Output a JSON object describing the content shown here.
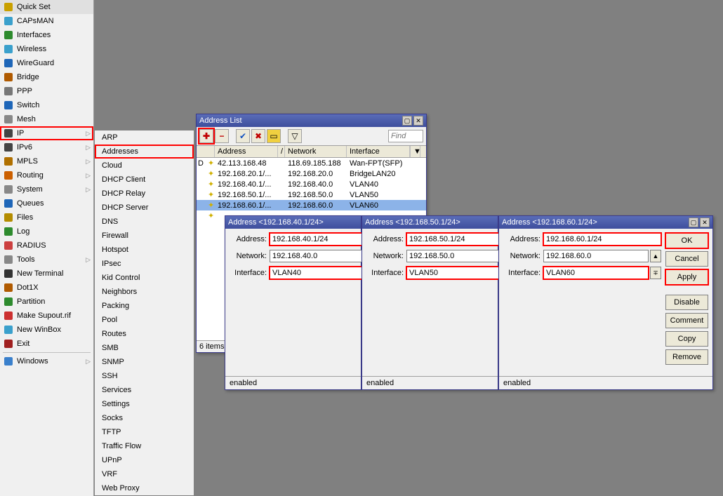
{
  "sidebar": [
    {
      "label": "Quick Set",
      "icon": "#c9a000",
      "arrow": false
    },
    {
      "label": "CAPsMAN",
      "icon": "#3aa0cc",
      "arrow": false
    },
    {
      "label": "Interfaces",
      "icon": "#2e8b2e",
      "arrow": false
    },
    {
      "label": "Wireless",
      "icon": "#3aa0cc",
      "arrow": false
    },
    {
      "label": "WireGuard",
      "icon": "#1e66b8",
      "arrow": false
    },
    {
      "label": "Bridge",
      "icon": "#b05a00",
      "arrow": false
    },
    {
      "label": "PPP",
      "icon": "#777",
      "arrow": false
    },
    {
      "label": "Switch",
      "icon": "#1e66b8",
      "arrow": false
    },
    {
      "label": "Mesh",
      "icon": "#888",
      "arrow": false
    },
    {
      "label": "IP",
      "icon": "#444",
      "arrow": true,
      "highlight": true
    },
    {
      "label": "IPv6",
      "icon": "#444",
      "arrow": true
    },
    {
      "label": "MPLS",
      "icon": "#b07000",
      "arrow": true
    },
    {
      "label": "Routing",
      "icon": "#cc6000",
      "arrow": true
    },
    {
      "label": "System",
      "icon": "#888",
      "arrow": true
    },
    {
      "label": "Queues",
      "icon": "#1e66b8",
      "arrow": false
    },
    {
      "label": "Files",
      "icon": "#b48c00",
      "arrow": false
    },
    {
      "label": "Log",
      "icon": "#2e8b2e",
      "arrow": false
    },
    {
      "label": "RADIUS",
      "icon": "#cc4040",
      "arrow": false
    },
    {
      "label": "Tools",
      "icon": "#888",
      "arrow": true
    },
    {
      "label": "New Terminal",
      "icon": "#333",
      "arrow": false
    },
    {
      "label": "Dot1X",
      "icon": "#b05a00",
      "arrow": false
    },
    {
      "label": "Partition",
      "icon": "#2e8b2e",
      "arrow": false
    },
    {
      "label": "Make Supout.rif",
      "icon": "#cc3030",
      "arrow": false
    },
    {
      "label": "New WinBox",
      "icon": "#3aa0cc",
      "arrow": false
    },
    {
      "label": "Exit",
      "icon": "#a02020",
      "arrow": false
    },
    {
      "label": "Windows",
      "icon": "#3a80cc",
      "arrow": true,
      "divider": true
    }
  ],
  "submenu": [
    "ARP",
    "Addresses",
    "Cloud",
    "DHCP Client",
    "DHCP Relay",
    "DHCP Server",
    "DNS",
    "Firewall",
    "Hotspot",
    "IPsec",
    "Kid Control",
    "Neighbors",
    "Packing",
    "Pool",
    "Routes",
    "SMB",
    "SNMP",
    "SSH",
    "Services",
    "Settings",
    "Socks",
    "TFTP",
    "Traffic Flow",
    "UPnP",
    "VRF",
    "Web Proxy"
  ],
  "submenu_highlight": 1,
  "addressList": {
    "title": "Address List",
    "find_placeholder": "Find",
    "headers": [
      "Address",
      "Network",
      "Interface"
    ],
    "rows": [
      {
        "flag": "D",
        "addr": "42.113.168.48",
        "net": "118.69.185.188",
        "if": "Wan-FPT(SFP)",
        "sel": false
      },
      {
        "flag": "",
        "addr": "192.168.20.1/...",
        "net": "192.168.20.0",
        "if": "BridgeLAN20",
        "sel": false
      },
      {
        "flag": "",
        "addr": "192.168.40.1/...",
        "net": "192.168.40.0",
        "if": "VLAN40",
        "sel": false
      },
      {
        "flag": "",
        "addr": "192.168.50.1/...",
        "net": "192.168.50.0",
        "if": "VLAN50",
        "sel": false
      },
      {
        "flag": "",
        "addr": "192.168.60.1/...",
        "net": "192.168.60.0",
        "if": "VLAN60",
        "sel": true
      }
    ],
    "status": "6 items"
  },
  "labels": {
    "address": "Address:",
    "network": "Network:",
    "interface": "Interface:",
    "enabled": "enabled"
  },
  "addrWins": [
    {
      "title": "Address <192.168.40.1/24>",
      "address": "192.168.40.1/24",
      "network": "192.168.40.0",
      "interface": "VLAN40"
    },
    {
      "title": "Address <192.168.50.1/24>",
      "address": "192.168.50.1/24",
      "network": "192.168.50.0",
      "interface": "VLAN50"
    },
    {
      "title": "Address <192.168.60.1/24>",
      "address": "192.168.60.1/24",
      "network": "192.168.60.0",
      "interface": "VLAN60"
    }
  ],
  "buttons": {
    "ok": "OK",
    "cancel": "Cancel",
    "apply": "Apply",
    "disable": "Disable",
    "comment": "Comment",
    "copy": "Copy",
    "remove": "Remove"
  }
}
